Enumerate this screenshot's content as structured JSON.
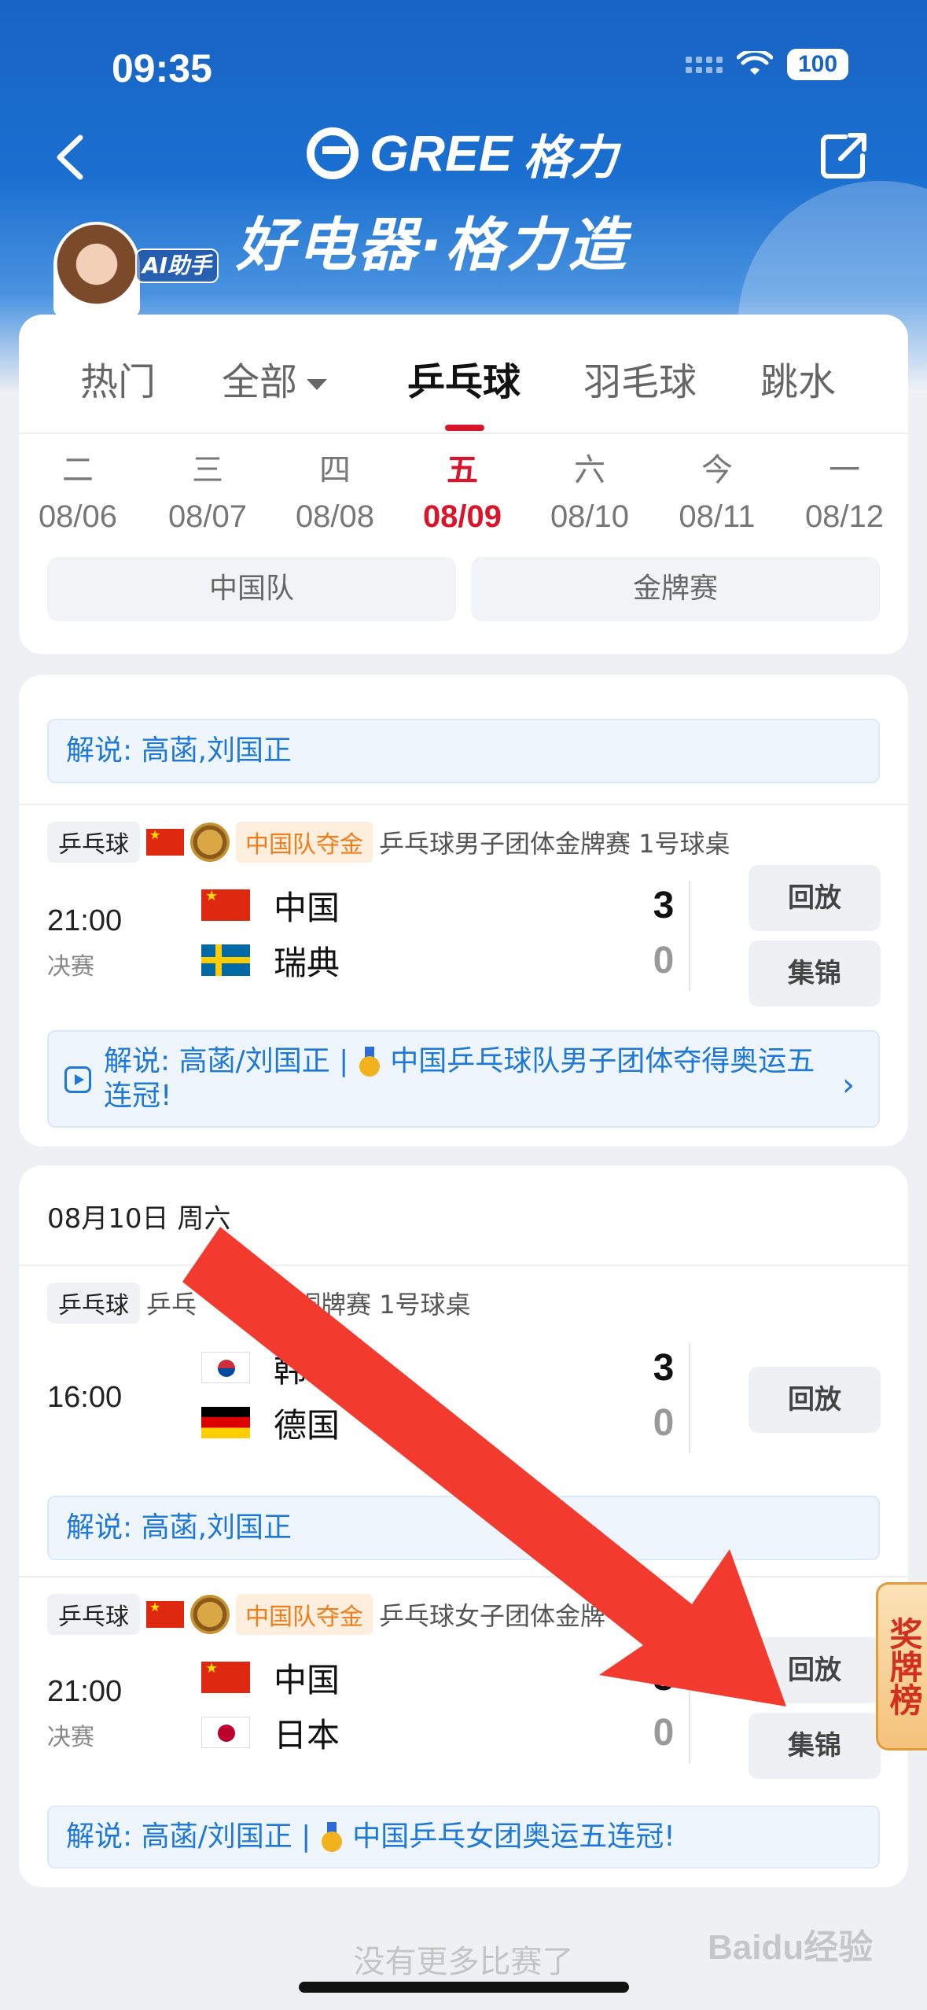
{
  "status": {
    "time": "09:35",
    "battery": "100"
  },
  "header": {
    "brand_en": "GREE",
    "brand_cn": "格力",
    "slogan": "好电器·格力造",
    "ai_badge": "AI助手"
  },
  "tabs": {
    "hot": "热门",
    "all": "全部",
    "table_tennis": "乒乓球",
    "badminton": "羽毛球",
    "diving": "跳水"
  },
  "dates": [
    {
      "weekday": "二",
      "date": "08/06"
    },
    {
      "weekday": "三",
      "date": "08/07"
    },
    {
      "weekday": "四",
      "date": "08/08"
    },
    {
      "weekday": "五",
      "date": "08/09"
    },
    {
      "weekday": "六",
      "date": "08/10"
    },
    {
      "weekday": "今",
      "date": "08/11"
    },
    {
      "weekday": "一",
      "date": "08/12"
    }
  ],
  "filters": {
    "china_team": "中国队",
    "gold_match": "金牌赛"
  },
  "card1": {
    "top_commentary": "解说: 高菡,刘国正",
    "match": {
      "sport": "乒乓球",
      "gold_tag": "中国队夺金",
      "title": "乒乓球男子团体金牌赛 1号球桌",
      "time": "21:00",
      "stage": "决赛",
      "team1": "中国",
      "score1": "3",
      "team2": "瑞典",
      "score2": "0",
      "replay": "回放",
      "highlights": "集锦",
      "commentary_prefix": "解说: 高菡/刘国正 |",
      "commentary_text": "中国乒乓球队男子团体夺得奥运五连冠!"
    }
  },
  "card2": {
    "date_header": "08月10日 周六",
    "match_a": {
      "sport": "乒乓球",
      "title_left": "乒乓",
      "title_right": "子团体铜牌赛 1号球桌",
      "time": "16:00",
      "team1": "韩",
      "score1": "3",
      "team2": "德国",
      "score2": "0",
      "replay": "回放",
      "commentary": "解说: 高菡,刘国正"
    },
    "match_b": {
      "sport": "乒乓球",
      "gold_tag": "中国队夺金",
      "title": "乒乓球女子团体金牌",
      "title_end": "桌",
      "time": "21:00",
      "stage": "决赛",
      "team1": "中国",
      "score1": "3",
      "team2": "日本",
      "score2": "0",
      "replay": "回放",
      "highlights": "集锦",
      "commentary_prefix": "解说: 高菡/刘国正 |",
      "commentary_text": "中国乒乓女团奥运五连冠!"
    }
  },
  "side_tab": "奖牌榜",
  "footer": "没有更多比赛了",
  "watermark": "Baidu经验",
  "colors": {
    "accent_red": "#d8152a",
    "brand_blue": "#1864c4",
    "link_blue": "#1e78d8",
    "gold_tag": "#f07d1a",
    "arrow_red": "#f23a2f"
  }
}
